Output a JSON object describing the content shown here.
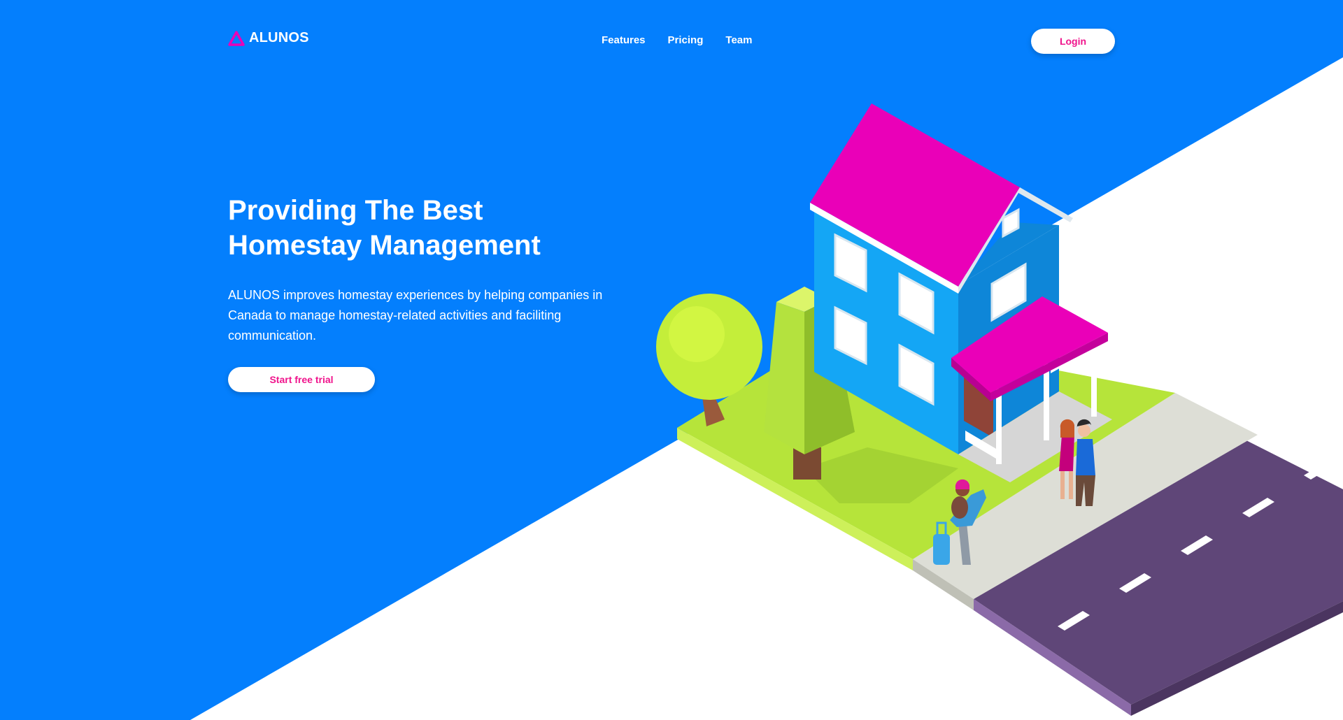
{
  "header": {
    "logo_text": "ALUNOS",
    "logo_icon": "triangle-logo-icon",
    "nav": [
      {
        "label": "Features"
      },
      {
        "label": "Pricing"
      },
      {
        "label": "Team"
      }
    ],
    "login_label": "Login"
  },
  "hero": {
    "title_line1": "Providing The Best",
    "title_line2": "Homestay Management",
    "description": "ALUNOS improves homestay experiences by helping companies in Canada to manage homestay-related activities and faciliting communication.",
    "cta_label": "Start free trial"
  },
  "colors": {
    "background_blue": "#047ffd",
    "accent_pink": "#f0148c",
    "roof_magenta": "#ea00b8",
    "house_blue": "#14a6f5",
    "grass_green": "#b8e83a",
    "road_purple": "#5f4678"
  }
}
